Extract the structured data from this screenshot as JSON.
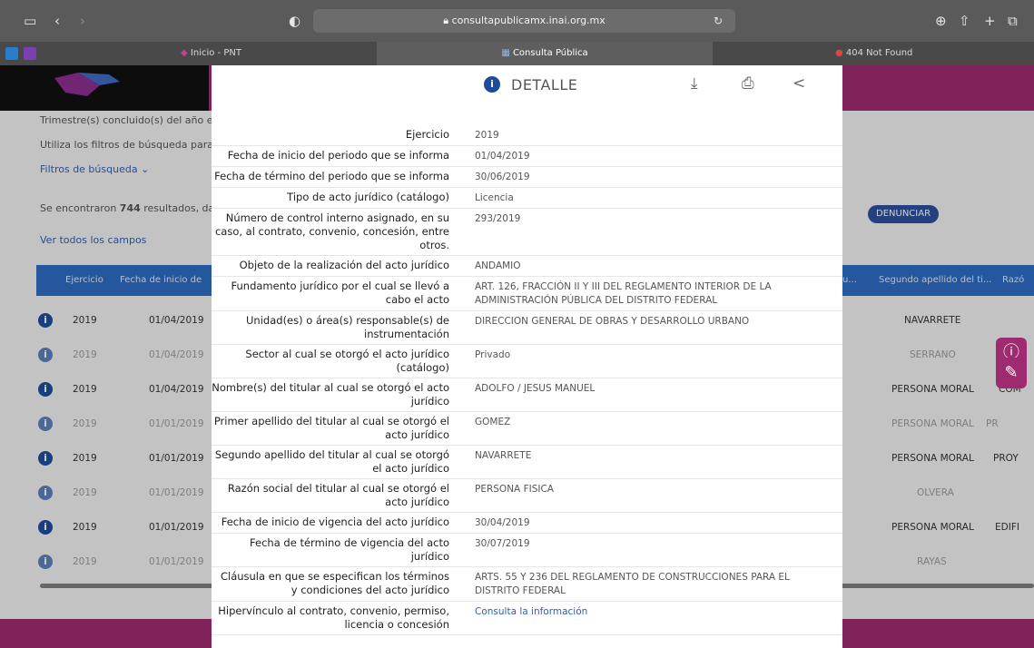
{
  "browser": {
    "url": "consultapublicamx.inai.org.mx",
    "tabs": [
      {
        "label": "Inicio - PNT"
      },
      {
        "label": "Consulta Pública"
      },
      {
        "label": "404 Not Found"
      }
    ]
  },
  "page": {
    "trimestre_text": "Trimestre(s) concluido(s) del año e",
    "filter_hint": "Utiliza los filtros de búsqueda para",
    "filters_link": "Filtros de búsqueda",
    "results_prefix": "Se encontraron ",
    "results_count": "744",
    "results_suffix": " resultados, da",
    "see_all": "Ver todos los campos",
    "denunciar": "DENUNCIAR",
    "table": {
      "headers": [
        "Ejercicio",
        "Fecha de inicio de",
        "u...",
        "Segundo apellido del ti...",
        "Razó"
      ],
      "rows": [
        {
          "year": "2019",
          "date": "01/04/2019",
          "apellido": "NAVARRETE",
          "razon": ""
        },
        {
          "year": "2019",
          "date": "01/04/2019",
          "apellido": "SERRANO",
          "razon": ""
        },
        {
          "year": "2019",
          "date": "01/04/2019",
          "apellido": "PERSONA MORAL",
          "razon": "COM"
        },
        {
          "year": "2019",
          "date": "01/01/2019",
          "apellido": "PERSONA MORAL",
          "razon": "PR"
        },
        {
          "year": "2019",
          "date": "01/01/2019",
          "apellido": "PERSONA MORAL",
          "razon": "PROY"
        },
        {
          "year": "2019",
          "date": "01/01/2019",
          "apellido": "OLVERA",
          "razon": ""
        },
        {
          "year": "2019",
          "date": "01/01/2019",
          "apellido": "PERSONA MORAL",
          "razon": "EDIFI"
        },
        {
          "year": "2019",
          "date": "01/01/2019",
          "apellido": "RAYAS",
          "razon": ""
        }
      ]
    }
  },
  "modal": {
    "title": "DETALLE",
    "rows": [
      {
        "label": "Ejercicio",
        "value": "2019"
      },
      {
        "label": "Fecha de inicio del periodo que se informa",
        "value": "01/04/2019"
      },
      {
        "label": "Fecha de término del periodo que se informa",
        "value": "30/06/2019"
      },
      {
        "label": "Tipo de acto jurídico (catálogo)",
        "value": "Licencia"
      },
      {
        "label": "Número de control interno asignado, en su caso, al contrato, convenio, concesión, entre otros.",
        "value": "293/2019"
      },
      {
        "label": "Objeto de la realización del acto jurídico",
        "value": "ANDAMIO"
      },
      {
        "label": "Fundamento jurídico por el cual se llevó a cabo el acto",
        "value": "ART. 126, FRACCIÓN II Y III DEL REGLAMENTO INTERIOR DE LA ADMINISTRACIÓN PÚBLICA DEL DISTRITO FEDERAL"
      },
      {
        "label": "Unidad(es) o área(s) responsable(s) de instrumentación",
        "value": "DIRECCION GENERAL DE OBRAS Y DESARROLLO URBANO"
      },
      {
        "label": "Sector al cual se otorgó el acto jurídico (catálogo)",
        "value": "Privado"
      },
      {
        "label": "Nombre(s) del titular al cual se otorgó el acto jurídico",
        "value": "ADOLFO / JESUS MANUEL"
      },
      {
        "label": "Primer apellido del titular al cual se otorgó el acto jurídico",
        "value": "GOMEZ"
      },
      {
        "label": "Segundo apellido del titular al cual se otorgó el acto jurídico",
        "value": "NAVARRETE"
      },
      {
        "label": "Razón social del titular al cual se otorgó el acto jurídico",
        "value": "PERSONA FISICA"
      },
      {
        "label": "Fecha de inicio de vigencia del acto jurídico",
        "value": "30/04/2019"
      },
      {
        "label": "Fecha de término de vigencia del acto jurídico",
        "value": "30/07/2019"
      },
      {
        "label": "Cláusula en que se especifican los términos y condiciones del acto jurídico",
        "value": "ARTS. 55 Y 236 DEL REGLAMENTO DE CONSTRUCCIONES PARA EL DISTRITO FEDERAL"
      },
      {
        "label": "Hipervínculo al contrato, convenio, permiso, licencia o concesión",
        "value": "Consulta la información"
      }
    ]
  }
}
